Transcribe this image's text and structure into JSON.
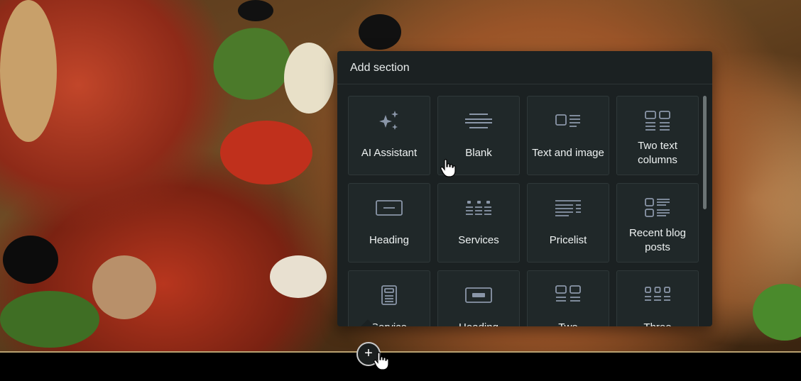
{
  "panel": {
    "title": "Add section"
  },
  "tiles": [
    {
      "label": "AI Assistant",
      "icon": "sparkles-icon"
    },
    {
      "label": "Blank",
      "icon": "blank-lines-icon"
    },
    {
      "label": "Text and image",
      "icon": "text-image-icon"
    },
    {
      "label": "Two text columns",
      "icon": "two-columns-icon"
    },
    {
      "label": "Heading",
      "icon": "heading-icon"
    },
    {
      "label": "Services",
      "icon": "services-icon"
    },
    {
      "label": "Pricelist",
      "icon": "pricelist-icon"
    },
    {
      "label": "Recent blog posts",
      "icon": "blog-posts-icon"
    },
    {
      "label": "Service",
      "icon": "service-icon"
    },
    {
      "label": "Heading",
      "icon": "heading-image-icon"
    },
    {
      "label": "Two",
      "icon": "two-image-columns-icon"
    },
    {
      "label": "Three",
      "icon": "three-columns-icon"
    }
  ],
  "add_button": {
    "symbol": "+"
  },
  "colors": {
    "icon": "#8a96a8",
    "panel_bg": "#1b2122",
    "tile_bg": "#202829"
  }
}
